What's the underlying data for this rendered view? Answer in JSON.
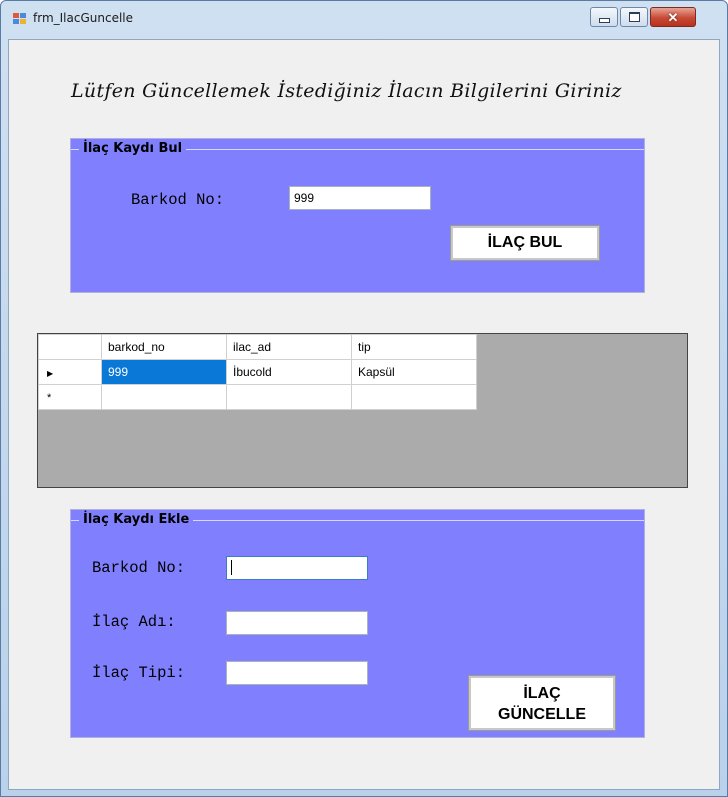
{
  "window": {
    "title": "frm_IlacGuncelle",
    "controls": {
      "minimize_icon": "minimize-icon",
      "maximize_icon": "maximize-icon",
      "close_icon": "close-icon"
    }
  },
  "heading": "Lütfen Güncellemek İstediğiniz İlacın Bilgilerini Giriniz",
  "find_group": {
    "title": "İlaç Kaydı Bul",
    "barkod_label": "Barkod No:",
    "barkod_value": "999",
    "button_label": "İLAÇ BUL"
  },
  "grid": {
    "columns": [
      "barkod_no",
      "ilac_ad",
      "tip"
    ],
    "rows": [
      {
        "marker": "▶",
        "barkod_no": "999",
        "ilac_ad": "İbucold",
        "tip": "Kapsül"
      },
      {
        "marker": "*",
        "barkod_no": "",
        "ilac_ad": "",
        "tip": ""
      }
    ]
  },
  "update_group": {
    "title": "İlaç Kaydı Ekle",
    "barkod_label": "Barkod No:",
    "ad_label": "İlaç Adı:",
    "tip_label": "İlaç Tipi:",
    "barkod_value": "",
    "ad_value": "",
    "tip_value": "",
    "button_line1": "İLAÇ",
    "button_line2": "GÜNCELLE"
  },
  "colors": {
    "group_bg": "#8080ff",
    "selection": "#0a78d7",
    "grid_bg": "#ababab",
    "client_bg": "#f0f0f0"
  }
}
